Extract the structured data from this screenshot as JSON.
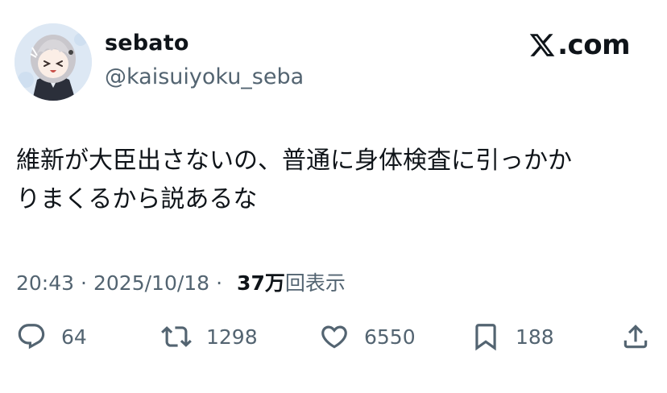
{
  "author": {
    "display_name": "sebato",
    "handle": "@kaisuiyoku_seba"
  },
  "brand": {
    "domain": ".com",
    "icon": "x-logo-icon"
  },
  "tweet": {
    "text_lines": [
      "維新が大臣出さないの、普通に身体検査に引っかか",
      "りまくるから説あるな"
    ]
  },
  "meta": {
    "time": "20:43",
    "separator": "·",
    "date": "2025/10/18",
    "views_count": "37万",
    "views_label": "回表示"
  },
  "actions": {
    "reply": {
      "icon": "reply-icon",
      "count": "64"
    },
    "retweet": {
      "icon": "retweet-icon",
      "count": "1298"
    },
    "like": {
      "icon": "heart-icon",
      "count": "6550"
    },
    "bookmark": {
      "icon": "bookmark-icon",
      "count": "188"
    },
    "share": {
      "icon": "share-icon"
    }
  },
  "colors": {
    "text_primary": "#0f1419",
    "text_secondary": "#536471",
    "background": "#ffffff"
  }
}
